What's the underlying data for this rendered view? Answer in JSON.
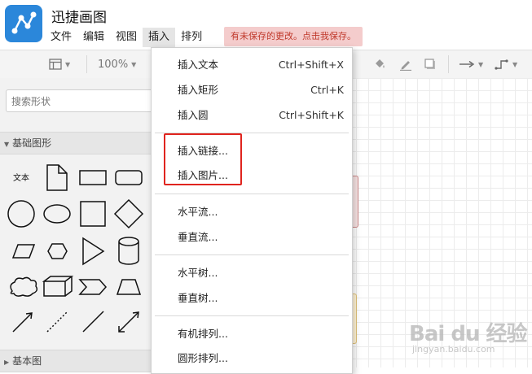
{
  "app": {
    "title": "迅捷画图"
  },
  "menubar": {
    "items": [
      "文件",
      "编辑",
      "视图",
      "插入",
      "排列"
    ],
    "active": "插入"
  },
  "unsaved_notice": "有未保存的更改。点击我保存。",
  "toolbar": {
    "zoom": "100%"
  },
  "sidebar": {
    "search_placeholder": "搜索形状",
    "sections": [
      "基础图形",
      "基本图"
    ],
    "basic_shapes_text_label": "文本"
  },
  "insert_menu": {
    "items": [
      {
        "label": "插入文本",
        "shortcut": "Ctrl+Shift+X"
      },
      {
        "label": "插入矩形",
        "shortcut": "Ctrl+K"
      },
      {
        "label": "插入圆",
        "shortcut": "Ctrl+Shift+K"
      },
      {
        "label": "插入链接...",
        "shortcut": ""
      },
      {
        "label": "插入图片...",
        "shortcut": ""
      },
      {
        "label": "水平流...",
        "shortcut": ""
      },
      {
        "label": "垂直流...",
        "shortcut": ""
      },
      {
        "label": "水平树...",
        "shortcut": ""
      },
      {
        "label": "垂直树...",
        "shortcut": ""
      },
      {
        "label": "有机排列...",
        "shortcut": ""
      },
      {
        "label": "圆形排列...",
        "shortcut": ""
      }
    ]
  },
  "watermark": {
    "main": "Bai du 经验",
    "sub": "jingyan.baidu.com"
  },
  "colors": {
    "logo": "#2b87da",
    "highlight": "#e0241e",
    "unsaved_bg": "#f4cccc",
    "unsaved_text": "#c0392b"
  }
}
